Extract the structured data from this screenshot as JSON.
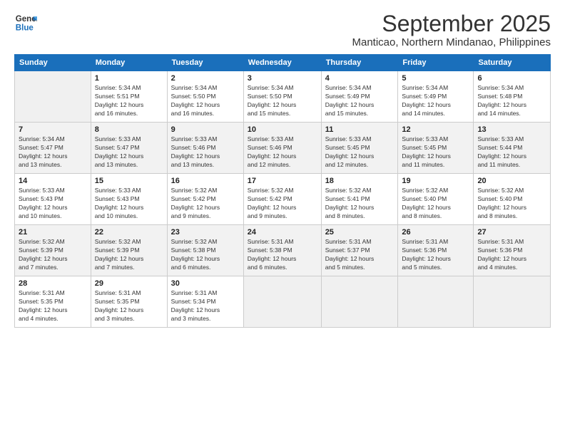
{
  "logo": {
    "line1": "General",
    "line2": "Blue"
  },
  "header": {
    "month": "September 2025",
    "location": "Manticao, Northern Mindanao, Philippines"
  },
  "days_of_week": [
    "Sunday",
    "Monday",
    "Tuesday",
    "Wednesday",
    "Thursday",
    "Friday",
    "Saturday"
  ],
  "weeks": [
    [
      {
        "num": "",
        "info": ""
      },
      {
        "num": "1",
        "info": "Sunrise: 5:34 AM\nSunset: 5:51 PM\nDaylight: 12 hours\nand 16 minutes."
      },
      {
        "num": "2",
        "info": "Sunrise: 5:34 AM\nSunset: 5:50 PM\nDaylight: 12 hours\nand 16 minutes."
      },
      {
        "num": "3",
        "info": "Sunrise: 5:34 AM\nSunset: 5:50 PM\nDaylight: 12 hours\nand 15 minutes."
      },
      {
        "num": "4",
        "info": "Sunrise: 5:34 AM\nSunset: 5:49 PM\nDaylight: 12 hours\nand 15 minutes."
      },
      {
        "num": "5",
        "info": "Sunrise: 5:34 AM\nSunset: 5:49 PM\nDaylight: 12 hours\nand 14 minutes."
      },
      {
        "num": "6",
        "info": "Sunrise: 5:34 AM\nSunset: 5:48 PM\nDaylight: 12 hours\nand 14 minutes."
      }
    ],
    [
      {
        "num": "7",
        "info": "Sunrise: 5:34 AM\nSunset: 5:47 PM\nDaylight: 12 hours\nand 13 minutes."
      },
      {
        "num": "8",
        "info": "Sunrise: 5:33 AM\nSunset: 5:47 PM\nDaylight: 12 hours\nand 13 minutes."
      },
      {
        "num": "9",
        "info": "Sunrise: 5:33 AM\nSunset: 5:46 PM\nDaylight: 12 hours\nand 13 minutes."
      },
      {
        "num": "10",
        "info": "Sunrise: 5:33 AM\nSunset: 5:46 PM\nDaylight: 12 hours\nand 12 minutes."
      },
      {
        "num": "11",
        "info": "Sunrise: 5:33 AM\nSunset: 5:45 PM\nDaylight: 12 hours\nand 12 minutes."
      },
      {
        "num": "12",
        "info": "Sunrise: 5:33 AM\nSunset: 5:45 PM\nDaylight: 12 hours\nand 11 minutes."
      },
      {
        "num": "13",
        "info": "Sunrise: 5:33 AM\nSunset: 5:44 PM\nDaylight: 12 hours\nand 11 minutes."
      }
    ],
    [
      {
        "num": "14",
        "info": "Sunrise: 5:33 AM\nSunset: 5:43 PM\nDaylight: 12 hours\nand 10 minutes."
      },
      {
        "num": "15",
        "info": "Sunrise: 5:33 AM\nSunset: 5:43 PM\nDaylight: 12 hours\nand 10 minutes."
      },
      {
        "num": "16",
        "info": "Sunrise: 5:32 AM\nSunset: 5:42 PM\nDaylight: 12 hours\nand 9 minutes."
      },
      {
        "num": "17",
        "info": "Sunrise: 5:32 AM\nSunset: 5:42 PM\nDaylight: 12 hours\nand 9 minutes."
      },
      {
        "num": "18",
        "info": "Sunrise: 5:32 AM\nSunset: 5:41 PM\nDaylight: 12 hours\nand 8 minutes."
      },
      {
        "num": "19",
        "info": "Sunrise: 5:32 AM\nSunset: 5:40 PM\nDaylight: 12 hours\nand 8 minutes."
      },
      {
        "num": "20",
        "info": "Sunrise: 5:32 AM\nSunset: 5:40 PM\nDaylight: 12 hours\nand 8 minutes."
      }
    ],
    [
      {
        "num": "21",
        "info": "Sunrise: 5:32 AM\nSunset: 5:39 PM\nDaylight: 12 hours\nand 7 minutes."
      },
      {
        "num": "22",
        "info": "Sunrise: 5:32 AM\nSunset: 5:39 PM\nDaylight: 12 hours\nand 7 minutes."
      },
      {
        "num": "23",
        "info": "Sunrise: 5:32 AM\nSunset: 5:38 PM\nDaylight: 12 hours\nand 6 minutes."
      },
      {
        "num": "24",
        "info": "Sunrise: 5:31 AM\nSunset: 5:38 PM\nDaylight: 12 hours\nand 6 minutes."
      },
      {
        "num": "25",
        "info": "Sunrise: 5:31 AM\nSunset: 5:37 PM\nDaylight: 12 hours\nand 5 minutes."
      },
      {
        "num": "26",
        "info": "Sunrise: 5:31 AM\nSunset: 5:36 PM\nDaylight: 12 hours\nand 5 minutes."
      },
      {
        "num": "27",
        "info": "Sunrise: 5:31 AM\nSunset: 5:36 PM\nDaylight: 12 hours\nand 4 minutes."
      }
    ],
    [
      {
        "num": "28",
        "info": "Sunrise: 5:31 AM\nSunset: 5:35 PM\nDaylight: 12 hours\nand 4 minutes."
      },
      {
        "num": "29",
        "info": "Sunrise: 5:31 AM\nSunset: 5:35 PM\nDaylight: 12 hours\nand 3 minutes."
      },
      {
        "num": "30",
        "info": "Sunrise: 5:31 AM\nSunset: 5:34 PM\nDaylight: 12 hours\nand 3 minutes."
      },
      {
        "num": "",
        "info": ""
      },
      {
        "num": "",
        "info": ""
      },
      {
        "num": "",
        "info": ""
      },
      {
        "num": "",
        "info": ""
      }
    ]
  ]
}
